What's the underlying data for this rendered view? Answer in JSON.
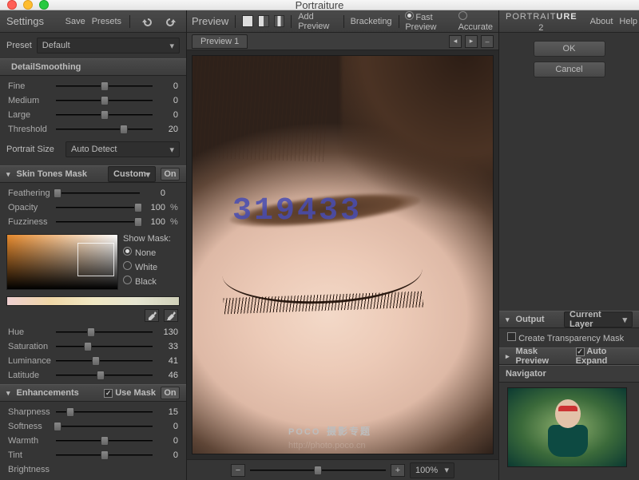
{
  "window": {
    "title": "Portraiture"
  },
  "settings": {
    "title": "Settings",
    "save": "Save",
    "presets": "Presets",
    "preset_label": "Preset",
    "preset_value": "Default",
    "detail_smoothing": {
      "title": "DetailSmoothing",
      "fine_label": "Fine",
      "fine_val": "0",
      "medium_label": "Medium",
      "medium_val": "0",
      "large_label": "Large",
      "large_val": "0",
      "threshold_label": "Threshold",
      "threshold_val": "20",
      "portrait_size_label": "Portrait Size",
      "portrait_size_value": "Auto Detect"
    },
    "skin_mask": {
      "title": "Skin Tones Mask",
      "mode": "Custom",
      "on": "On",
      "feathering_label": "Feathering",
      "feathering_val": "0",
      "opacity_label": "Opacity",
      "opacity_val": "100",
      "fuzziness_label": "Fuzziness",
      "fuzziness_val": "100",
      "show_mask": "Show Mask:",
      "opt_none": "None",
      "opt_white": "White",
      "opt_black": "Black",
      "hue_label": "Hue",
      "hue_val": "130",
      "sat_label": "Saturation",
      "sat_val": "33",
      "lum_label": "Luminance",
      "lum_val": "41",
      "lat_label": "Latitude",
      "lat_val": "46"
    },
    "enhancements": {
      "title": "Enhancements",
      "use_mask": "Use Mask",
      "on": "On",
      "sharpness_label": "Sharpness",
      "sharpness_val": "15",
      "softness_label": "Softness",
      "softness_val": "0",
      "warmth_label": "Warmth",
      "warmth_val": "0",
      "tint_label": "Tint",
      "tint_val": "0",
      "brightness_label": "Brightness"
    }
  },
  "preview": {
    "title": "Preview",
    "add_preview": "Add Preview",
    "bracketing": "Bracketing",
    "fast": "Fast Preview",
    "accurate": "Accurate",
    "tab1": "Preview 1",
    "zoom_value": "100%",
    "watermark_num": "319433",
    "watermark_brand": "POCO",
    "watermark_sub": "摄影专题",
    "watermark_url": "http://photo.poco.cn"
  },
  "right": {
    "brand_a": "PORTRAIT",
    "brand_b": "URE",
    "brand_v": "2",
    "about": "About",
    "help": "Help",
    "ok": "OK",
    "cancel": "Cancel",
    "output": "Output",
    "output_value": "Current Layer",
    "create_mask": "Create Transparency Mask",
    "mask_preview": "Mask Preview",
    "auto_expand": "Auto Expand",
    "navigator": "Navigator"
  }
}
